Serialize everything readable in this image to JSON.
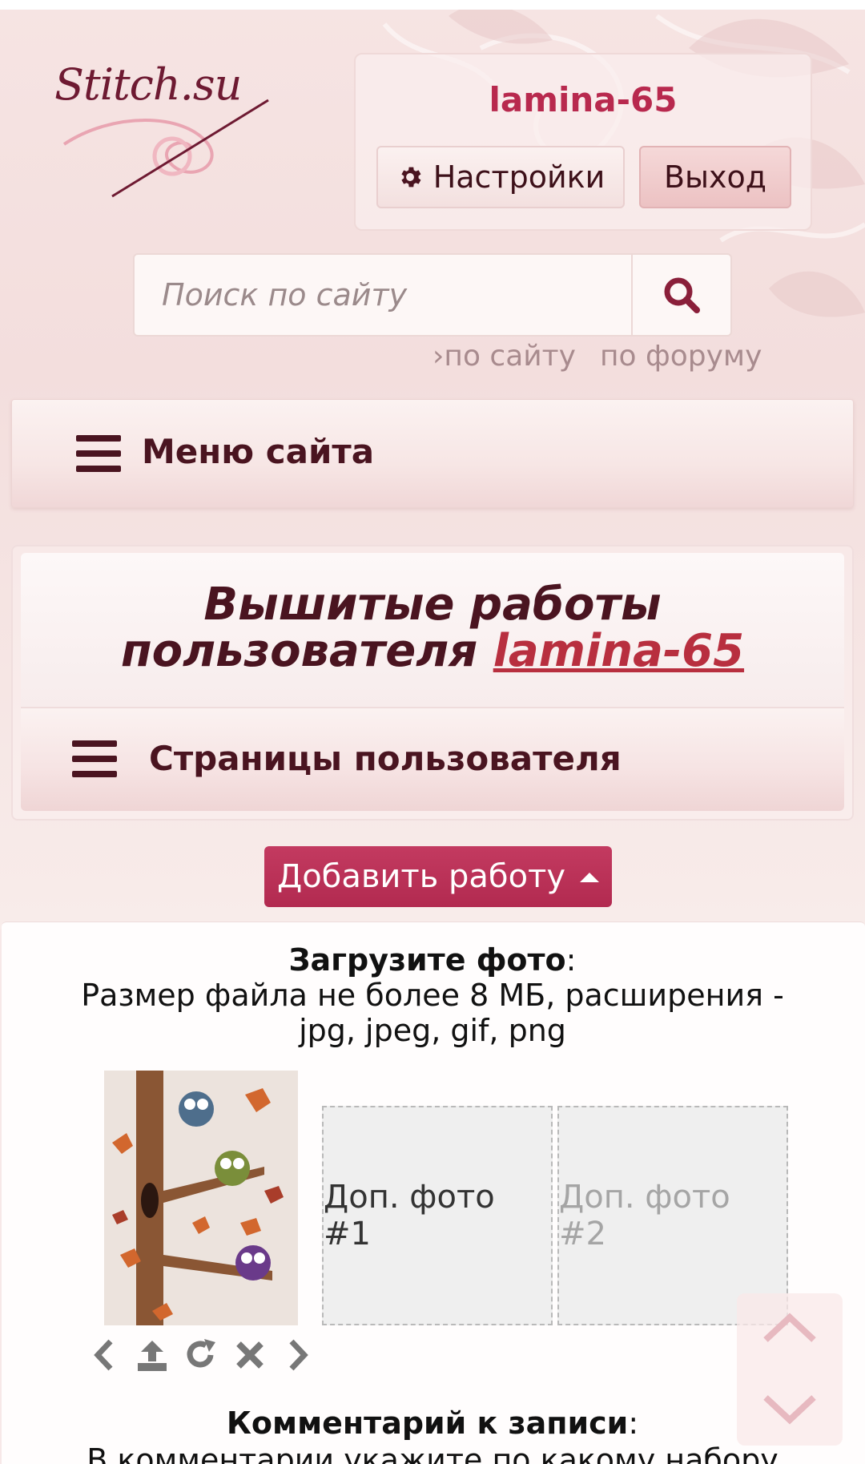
{
  "site": {
    "logo_text": "Stitch.su"
  },
  "user": {
    "name": "lamina-65",
    "settings_label": "Настройки",
    "logout_label": "Выход"
  },
  "search": {
    "placeholder": "Поиск по сайту",
    "scope_site": "по сайту",
    "scope_forum": "по форуму"
  },
  "menu": {
    "label": "Меню сайта"
  },
  "page": {
    "title_line1": "Вышитые работы",
    "title_line2_prefix": "пользователя ",
    "title_user_link": "lamina-65",
    "user_pages_label": "Страницы пользователя"
  },
  "add_work": {
    "label": "Добавить работу"
  },
  "upload": {
    "heading": "Загрузите фото",
    "heading_suffix": ":",
    "description": "Размер файла не более 8 МБ, расширения - jpg, jpeg, gif, png",
    "slot1": "Доп. фото #1",
    "slot2": "Доп. фото #2"
  },
  "comment": {
    "heading": "Комментарий к записи",
    "heading_suffix": ":",
    "description": "В комментарии укажите по какому набору"
  },
  "colors": {
    "accent": "#b8294e",
    "button": "#c03558",
    "text_dark": "#4a1420",
    "link": "#b82f3f"
  },
  "icons": [
    "gear-icon",
    "search-icon",
    "hamburger-icon",
    "caret-up-icon",
    "prev-icon",
    "upload-icon",
    "rotate-icon",
    "delete-icon",
    "next-icon",
    "scroll-up-icon",
    "scroll-down-icon"
  ]
}
